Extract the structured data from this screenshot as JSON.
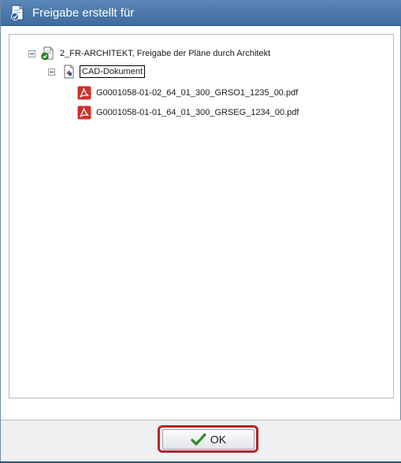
{
  "background_fragment": "g",
  "dialog": {
    "title": "Freigabe erstellt für",
    "title_icon": "document-approval-icon"
  },
  "tree": {
    "root": {
      "label": "2_FR-ARCHITEKT, Freigabe der Pläne durch Architekt",
      "icon": "approval-document-icon",
      "expanded": true,
      "children": [
        {
          "label": "CAD-Dokument",
          "icon": "cad-document-icon",
          "expanded": true,
          "selected": true,
          "children": [
            {
              "label": "G0001058-01-02_64_01_300_GRSO1_1235_00.pdf",
              "icon": "pdf-icon"
            },
            {
              "label": "G0001058-01-01_64_01_300_GRSEG_1234_00.pdf",
              "icon": "pdf-icon"
            }
          ]
        }
      ]
    }
  },
  "footer": {
    "ok_label": "OK",
    "ok_icon": "checkmark-icon",
    "highlight_color": "#b3252a"
  },
  "colors": {
    "titlebar": "#4a78aa",
    "pdf_red": "#d0302a",
    "check_green": "#2e8b22"
  }
}
